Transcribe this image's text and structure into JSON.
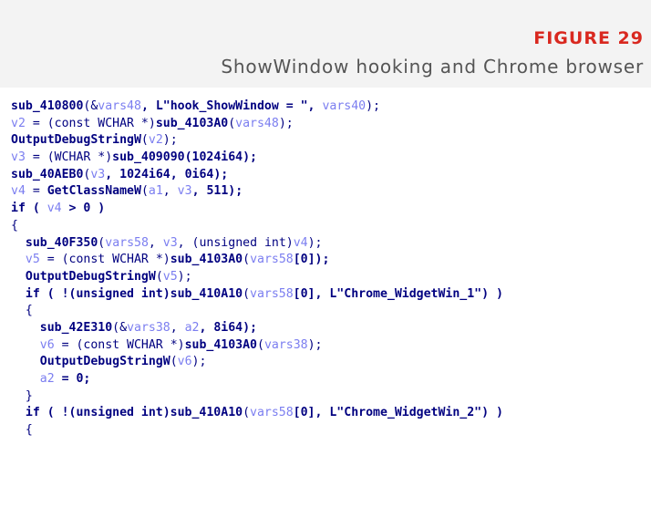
{
  "figure": {
    "label": "FIGURE 29",
    "caption": "ShowWindow hooking and Chrome browser"
  },
  "code_lines": [
    [
      {
        "t": "sub_410800",
        "c": "fn"
      },
      {
        "t": "(&",
        "c": "kw"
      },
      {
        "t": "vars48",
        "c": "var"
      },
      {
        "t": ", L\"hook_ShowWindow = \", ",
        "c": "str"
      },
      {
        "t": "vars40",
        "c": "var"
      },
      {
        "t": ");",
        "c": "kw"
      }
    ],
    [
      {
        "t": "v2",
        "c": "var"
      },
      {
        "t": " = (const WCHAR *)",
        "c": "kw"
      },
      {
        "t": "sub_4103A0",
        "c": "fn"
      },
      {
        "t": "(",
        "c": "kw"
      },
      {
        "t": "vars48",
        "c": "var"
      },
      {
        "t": ");",
        "c": "kw"
      }
    ],
    [
      {
        "t": "OutputDebugStringW",
        "c": "fn"
      },
      {
        "t": "(",
        "c": "kw"
      },
      {
        "t": "v2",
        "c": "var"
      },
      {
        "t": ");",
        "c": "kw"
      }
    ],
    [
      {
        "t": "v3",
        "c": "var"
      },
      {
        "t": " = (WCHAR *)",
        "c": "kw"
      },
      {
        "t": "sub_409090",
        "c": "fn"
      },
      {
        "t": "(1024i64);",
        "c": "str"
      }
    ],
    [
      {
        "t": "sub_40AEB0",
        "c": "fn"
      },
      {
        "t": "(",
        "c": "kw"
      },
      {
        "t": "v3",
        "c": "var"
      },
      {
        "t": ", 1024i64, 0i64);",
        "c": "str"
      }
    ],
    [
      {
        "t": "v4",
        "c": "var"
      },
      {
        "t": " = ",
        "c": "kw"
      },
      {
        "t": "GetClassNameW",
        "c": "fn"
      },
      {
        "t": "(",
        "c": "kw"
      },
      {
        "t": "a1",
        "c": "var"
      },
      {
        "t": ", ",
        "c": "kw"
      },
      {
        "t": "v3",
        "c": "var"
      },
      {
        "t": ", 511);",
        "c": "str"
      }
    ],
    [
      {
        "t": "if ( ",
        "c": "str"
      },
      {
        "t": "v4",
        "c": "var"
      },
      {
        "t": " > 0 )",
        "c": "str"
      }
    ],
    [
      {
        "t": "{",
        "c": "kw"
      }
    ],
    [
      {
        "t": "  ",
        "c": "kw"
      },
      {
        "t": "sub_40F350",
        "c": "fn"
      },
      {
        "t": "(",
        "c": "kw"
      },
      {
        "t": "vars58",
        "c": "var"
      },
      {
        "t": ", ",
        "c": "kw"
      },
      {
        "t": "v3",
        "c": "var"
      },
      {
        "t": ", (unsigned int)",
        "c": "kw"
      },
      {
        "t": "v4",
        "c": "var"
      },
      {
        "t": ");",
        "c": "kw"
      }
    ],
    [
      {
        "t": "  ",
        "c": "kw"
      },
      {
        "t": "v5",
        "c": "var"
      },
      {
        "t": " = (const WCHAR *)",
        "c": "kw"
      },
      {
        "t": "sub_4103A0",
        "c": "fn"
      },
      {
        "t": "(",
        "c": "kw"
      },
      {
        "t": "vars58",
        "c": "var"
      },
      {
        "t": "[0]);",
        "c": "str"
      }
    ],
    [
      {
        "t": "  ",
        "c": "kw"
      },
      {
        "t": "OutputDebugStringW",
        "c": "fn"
      },
      {
        "t": "(",
        "c": "kw"
      },
      {
        "t": "v5",
        "c": "var"
      },
      {
        "t": ");",
        "c": "kw"
      }
    ],
    [
      {
        "t": "  if ( !(unsigned int)",
        "c": "str"
      },
      {
        "t": "sub_410A10",
        "c": "fn"
      },
      {
        "t": "(",
        "c": "kw"
      },
      {
        "t": "vars58",
        "c": "var"
      },
      {
        "t": "[0], L\"Chrome_WidgetWin_1\") )",
        "c": "str"
      }
    ],
    [
      {
        "t": "  {",
        "c": "kw"
      }
    ],
    [
      {
        "t": "    ",
        "c": "kw"
      },
      {
        "t": "sub_42E310",
        "c": "fn"
      },
      {
        "t": "(&",
        "c": "kw"
      },
      {
        "t": "vars38",
        "c": "var"
      },
      {
        "t": ", ",
        "c": "kw"
      },
      {
        "t": "a2",
        "c": "var"
      },
      {
        "t": ", 8i64);",
        "c": "str"
      }
    ],
    [
      {
        "t": "    ",
        "c": "kw"
      },
      {
        "t": "v6",
        "c": "var"
      },
      {
        "t": " = (const WCHAR *)",
        "c": "kw"
      },
      {
        "t": "sub_4103A0",
        "c": "fn"
      },
      {
        "t": "(",
        "c": "kw"
      },
      {
        "t": "vars38",
        "c": "var"
      },
      {
        "t": ");",
        "c": "kw"
      }
    ],
    [
      {
        "t": "    ",
        "c": "kw"
      },
      {
        "t": "OutputDebugStringW",
        "c": "fn"
      },
      {
        "t": "(",
        "c": "kw"
      },
      {
        "t": "v6",
        "c": "var"
      },
      {
        "t": ");",
        "c": "kw"
      }
    ],
    [
      {
        "t": "    ",
        "c": "kw"
      },
      {
        "t": "a2",
        "c": "var"
      },
      {
        "t": " = 0;",
        "c": "str"
      }
    ],
    [
      {
        "t": "  }",
        "c": "kw"
      }
    ],
    [
      {
        "t": "  if ( !(unsigned int)",
        "c": "str"
      },
      {
        "t": "sub_410A10",
        "c": "fn"
      },
      {
        "t": "(",
        "c": "kw"
      },
      {
        "t": "vars58",
        "c": "var"
      },
      {
        "t": "[0], L\"Chrome_WidgetWin_2\") )",
        "c": "str"
      }
    ],
    [
      {
        "t": "  {",
        "c": "kw"
      }
    ]
  ]
}
